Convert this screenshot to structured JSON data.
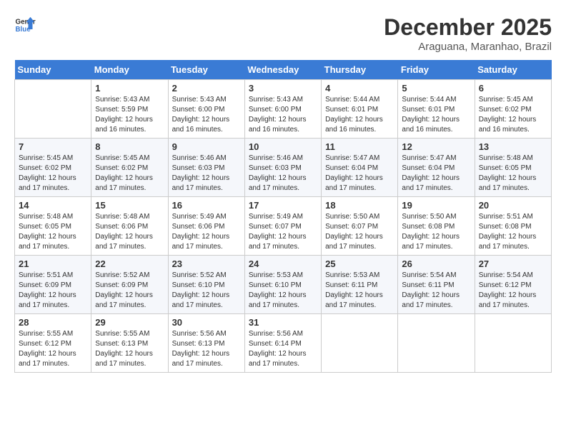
{
  "header": {
    "logo_line1": "General",
    "logo_line2": "Blue",
    "month": "December 2025",
    "location": "Araguana, Maranhao, Brazil"
  },
  "weekdays": [
    "Sunday",
    "Monday",
    "Tuesday",
    "Wednesday",
    "Thursday",
    "Friday",
    "Saturday"
  ],
  "weeks": [
    [
      {
        "day": "",
        "info": ""
      },
      {
        "day": "1",
        "info": "Sunrise: 5:43 AM\nSunset: 5:59 PM\nDaylight: 12 hours\nand 16 minutes."
      },
      {
        "day": "2",
        "info": "Sunrise: 5:43 AM\nSunset: 6:00 PM\nDaylight: 12 hours\nand 16 minutes."
      },
      {
        "day": "3",
        "info": "Sunrise: 5:43 AM\nSunset: 6:00 PM\nDaylight: 12 hours\nand 16 minutes."
      },
      {
        "day": "4",
        "info": "Sunrise: 5:44 AM\nSunset: 6:01 PM\nDaylight: 12 hours\nand 16 minutes."
      },
      {
        "day": "5",
        "info": "Sunrise: 5:44 AM\nSunset: 6:01 PM\nDaylight: 12 hours\nand 16 minutes."
      },
      {
        "day": "6",
        "info": "Sunrise: 5:45 AM\nSunset: 6:02 PM\nDaylight: 12 hours\nand 16 minutes."
      }
    ],
    [
      {
        "day": "7",
        "info": "Sunrise: 5:45 AM\nSunset: 6:02 PM\nDaylight: 12 hours\nand 17 minutes."
      },
      {
        "day": "8",
        "info": "Sunrise: 5:45 AM\nSunset: 6:02 PM\nDaylight: 12 hours\nand 17 minutes."
      },
      {
        "day": "9",
        "info": "Sunrise: 5:46 AM\nSunset: 6:03 PM\nDaylight: 12 hours\nand 17 minutes."
      },
      {
        "day": "10",
        "info": "Sunrise: 5:46 AM\nSunset: 6:03 PM\nDaylight: 12 hours\nand 17 minutes."
      },
      {
        "day": "11",
        "info": "Sunrise: 5:47 AM\nSunset: 6:04 PM\nDaylight: 12 hours\nand 17 minutes."
      },
      {
        "day": "12",
        "info": "Sunrise: 5:47 AM\nSunset: 6:04 PM\nDaylight: 12 hours\nand 17 minutes."
      },
      {
        "day": "13",
        "info": "Sunrise: 5:48 AM\nSunset: 6:05 PM\nDaylight: 12 hours\nand 17 minutes."
      }
    ],
    [
      {
        "day": "14",
        "info": "Sunrise: 5:48 AM\nSunset: 6:05 PM\nDaylight: 12 hours\nand 17 minutes."
      },
      {
        "day": "15",
        "info": "Sunrise: 5:48 AM\nSunset: 6:06 PM\nDaylight: 12 hours\nand 17 minutes."
      },
      {
        "day": "16",
        "info": "Sunrise: 5:49 AM\nSunset: 6:06 PM\nDaylight: 12 hours\nand 17 minutes."
      },
      {
        "day": "17",
        "info": "Sunrise: 5:49 AM\nSunset: 6:07 PM\nDaylight: 12 hours\nand 17 minutes."
      },
      {
        "day": "18",
        "info": "Sunrise: 5:50 AM\nSunset: 6:07 PM\nDaylight: 12 hours\nand 17 minutes."
      },
      {
        "day": "19",
        "info": "Sunrise: 5:50 AM\nSunset: 6:08 PM\nDaylight: 12 hours\nand 17 minutes."
      },
      {
        "day": "20",
        "info": "Sunrise: 5:51 AM\nSunset: 6:08 PM\nDaylight: 12 hours\nand 17 minutes."
      }
    ],
    [
      {
        "day": "21",
        "info": "Sunrise: 5:51 AM\nSunset: 6:09 PM\nDaylight: 12 hours\nand 17 minutes."
      },
      {
        "day": "22",
        "info": "Sunrise: 5:52 AM\nSunset: 6:09 PM\nDaylight: 12 hours\nand 17 minutes."
      },
      {
        "day": "23",
        "info": "Sunrise: 5:52 AM\nSunset: 6:10 PM\nDaylight: 12 hours\nand 17 minutes."
      },
      {
        "day": "24",
        "info": "Sunrise: 5:53 AM\nSunset: 6:10 PM\nDaylight: 12 hours\nand 17 minutes."
      },
      {
        "day": "25",
        "info": "Sunrise: 5:53 AM\nSunset: 6:11 PM\nDaylight: 12 hours\nand 17 minutes."
      },
      {
        "day": "26",
        "info": "Sunrise: 5:54 AM\nSunset: 6:11 PM\nDaylight: 12 hours\nand 17 minutes."
      },
      {
        "day": "27",
        "info": "Sunrise: 5:54 AM\nSunset: 6:12 PM\nDaylight: 12 hours\nand 17 minutes."
      }
    ],
    [
      {
        "day": "28",
        "info": "Sunrise: 5:55 AM\nSunset: 6:12 PM\nDaylight: 12 hours\nand 17 minutes."
      },
      {
        "day": "29",
        "info": "Sunrise: 5:55 AM\nSunset: 6:13 PM\nDaylight: 12 hours\nand 17 minutes."
      },
      {
        "day": "30",
        "info": "Sunrise: 5:56 AM\nSunset: 6:13 PM\nDaylight: 12 hours\nand 17 minutes."
      },
      {
        "day": "31",
        "info": "Sunrise: 5:56 AM\nSunset: 6:14 PM\nDaylight: 12 hours\nand 17 minutes."
      },
      {
        "day": "",
        "info": ""
      },
      {
        "day": "",
        "info": ""
      },
      {
        "day": "",
        "info": ""
      }
    ]
  ]
}
